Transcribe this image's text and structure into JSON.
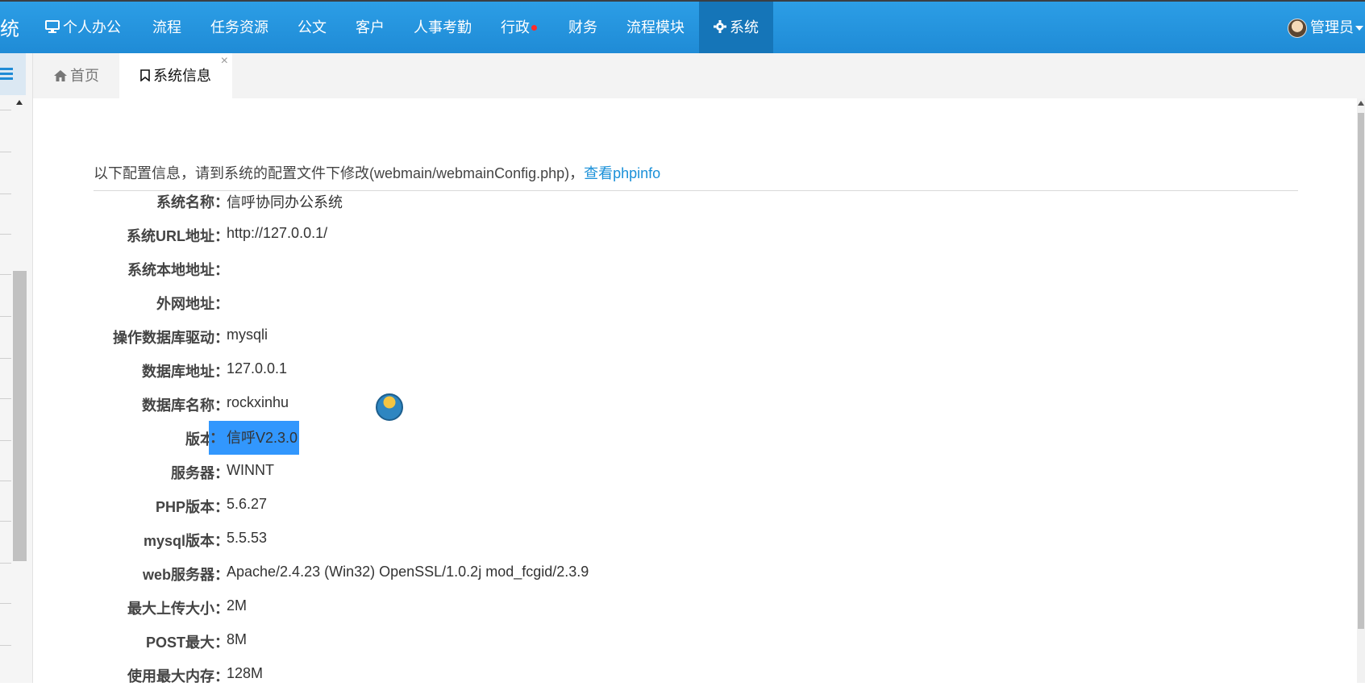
{
  "topnav": {
    "brand": "统",
    "items": [
      {
        "label": "个人办公",
        "icon": "monitor-icon"
      },
      {
        "label": "流程"
      },
      {
        "label": "任务资源"
      },
      {
        "label": "公文"
      },
      {
        "label": "客户"
      },
      {
        "label": "人事考勤"
      },
      {
        "label": "行政",
        "badge": "red-dot"
      },
      {
        "label": "财务"
      },
      {
        "label": "流程模块"
      },
      {
        "label": "系统",
        "icon": "gear-icon",
        "active": true
      }
    ],
    "user": "管理员"
  },
  "tabs": [
    {
      "label": "首页",
      "icon": "home-icon"
    },
    {
      "label": "系统信息",
      "icon": "bookmark-icon",
      "active": true,
      "close": "×"
    }
  ],
  "info": {
    "notice": "以下配置信息，请到系统的配置文件下修改(webmain/webmainConfig.php)，",
    "link": "查看phpinfo"
  },
  "rows": [
    {
      "label": "系统名称",
      "value": "信呼协同办公系统"
    },
    {
      "label": "系统URL地址",
      "value": "http://127.0.0.1/"
    },
    {
      "label": "系统本地地址",
      "value": ""
    },
    {
      "label": "外网地址",
      "value": ""
    },
    {
      "label": "操作数据库驱动",
      "value": "mysqli"
    },
    {
      "label": "数据库地址",
      "value": "127.0.0.1"
    },
    {
      "label": "数据库名称",
      "value": "rockxinhu"
    },
    {
      "label": "版本",
      "value": "信呼V2.3.0"
    },
    {
      "label": "服务器",
      "value": "WINNT"
    },
    {
      "label": "PHP版本",
      "value": "5.6.27"
    },
    {
      "label": "mysql版本",
      "value": "5.5.53"
    },
    {
      "label": "web服务器",
      "value": "Apache/2.4.23 (Win32) OpenSSL/1.0.2j mod_fcgid/2.3.9"
    },
    {
      "label": "最大上传大小",
      "value": "2M"
    },
    {
      "label": "POST最大",
      "value": "8M"
    },
    {
      "label": "使用最大内存",
      "value": "128M"
    }
  ],
  "colors": {
    "nav_bg": "#1f8bd6",
    "nav_active": "#1575b8",
    "link": "#1a90d8",
    "selection": "#3297fd"
  }
}
